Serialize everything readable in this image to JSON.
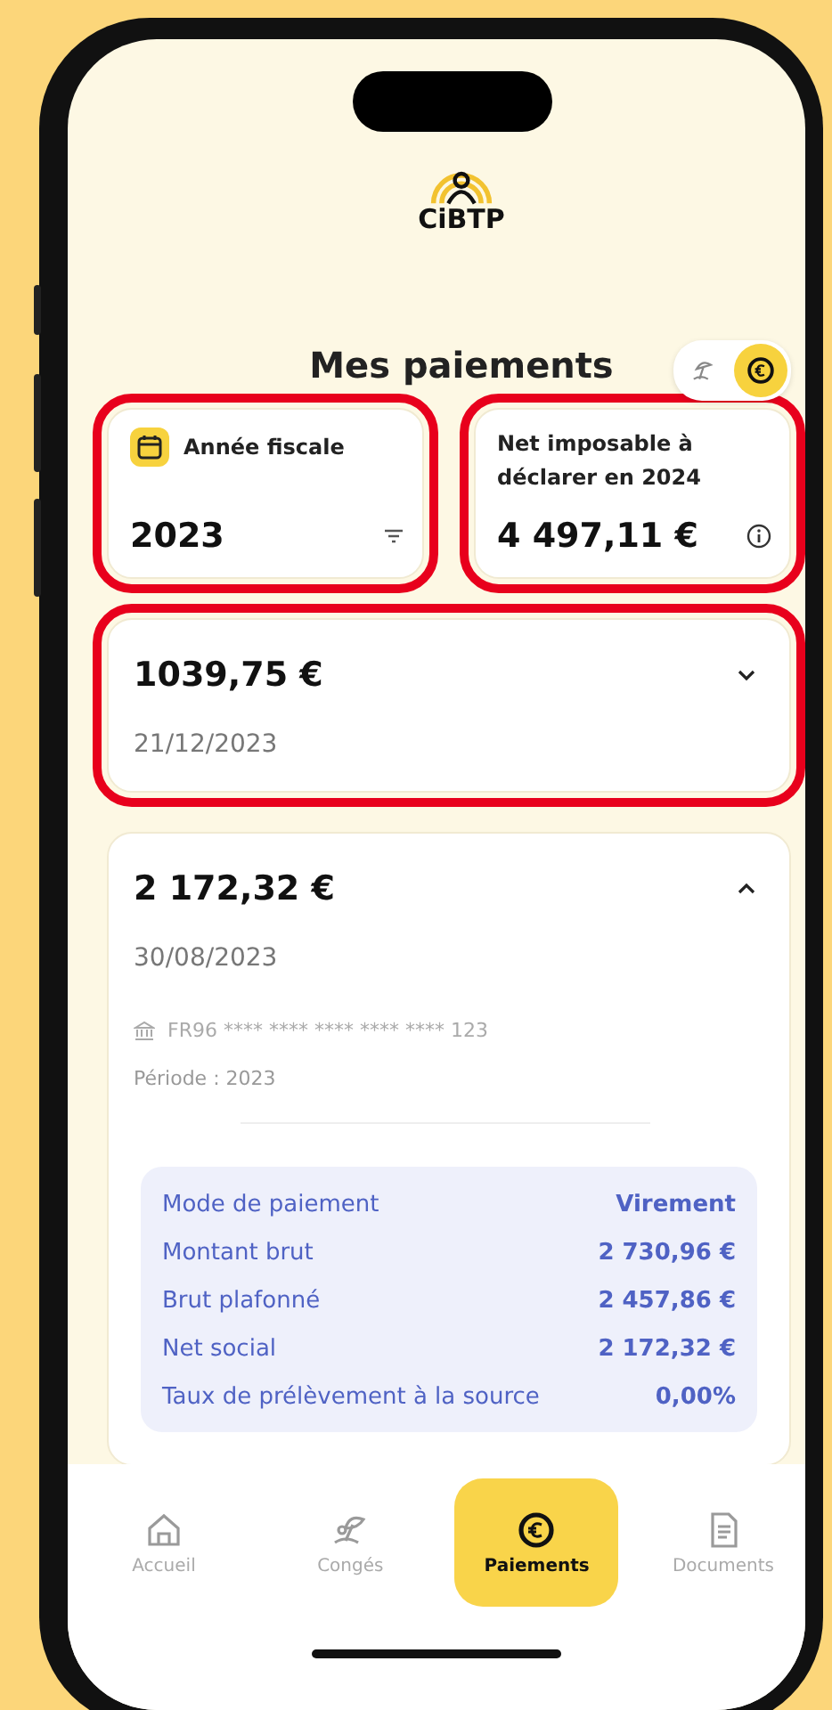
{
  "header": {
    "logo_text": "CiBTP",
    "title": "Mes paiements",
    "view_toggle": [
      {
        "kind": "leave",
        "selected": false
      },
      {
        "kind": "payments",
        "selected": true
      }
    ]
  },
  "summary": [
    {
      "kind": "year",
      "label": "Année fiscale",
      "value": "2023",
      "highlighted": true
    },
    {
      "kind": "net",
      "label": "Net imposable à déclarer en 2024",
      "value": "4 497,11 €",
      "highlighted": true
    }
  ],
  "payments": [
    {
      "amount": "1039,75 €",
      "date": "21/12/2023",
      "expanded": false,
      "highlighted": true
    },
    {
      "amount": "2 172,32 €",
      "date": "30/08/2023",
      "expanded": true,
      "highlighted": false,
      "iban": "FR96 **** **** **** **** **** 123",
      "period": "Période : 2023",
      "details": [
        {
          "label": "Mode de paiement",
          "value": "Virement"
        },
        {
          "label": "Montant brut",
          "value": "2 730,96 €"
        },
        {
          "label": "Brut plafonné",
          "value": "2 457,86 €"
        },
        {
          "label": "Net social",
          "value": "2 172,32 €"
        },
        {
          "label": "Taux de prélèvement à la source",
          "value": "0,00%"
        }
      ]
    }
  ],
  "tab_bar": [
    {
      "kind": "home",
      "label": "Accueil",
      "selected": false
    },
    {
      "kind": "leave",
      "label": "Congés",
      "selected": false
    },
    {
      "kind": "payments",
      "label": "Paiements",
      "selected": true
    },
    {
      "kind": "documents",
      "label": "Documents",
      "selected": false
    }
  ]
}
